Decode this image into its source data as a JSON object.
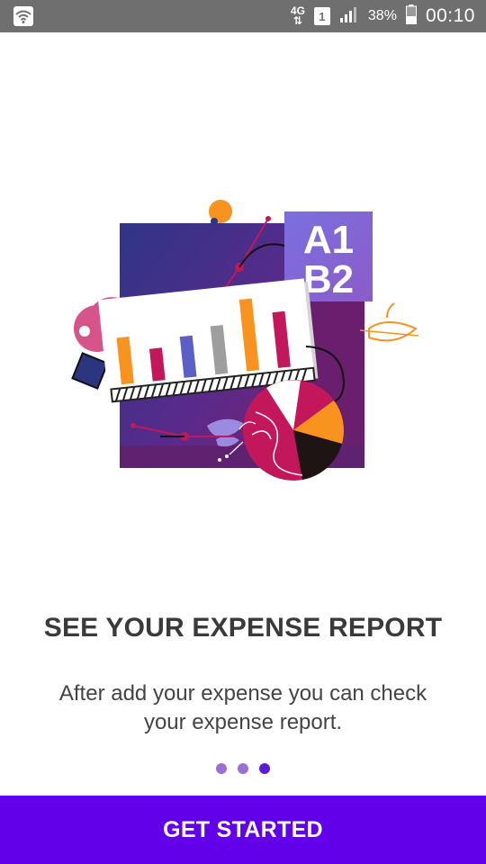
{
  "status_bar": {
    "network_type": "4G",
    "sim_slot": "1",
    "battery_percent": "38%",
    "time": "00:10",
    "icons": [
      "wifi-icon",
      "data-arrows-icon",
      "sim-icon",
      "signal-icon",
      "battery-icon"
    ]
  },
  "illustration": {
    "label_a": "A1",
    "label_b": "B2",
    "icon": "expense-report-illustration"
  },
  "onboarding": {
    "title": "SEE YOUR EXPENSE REPORT",
    "description": "After add your expense you can check your expense report.",
    "page_indicator": {
      "total": 3,
      "current": 3
    }
  },
  "cta": {
    "label": "GET STARTED"
  },
  "colors": {
    "primary": "#6200ea",
    "status_bar": "#6f6f6f",
    "dot_inactive": "#9b70d6",
    "dot_active": "#5d1bd9"
  }
}
